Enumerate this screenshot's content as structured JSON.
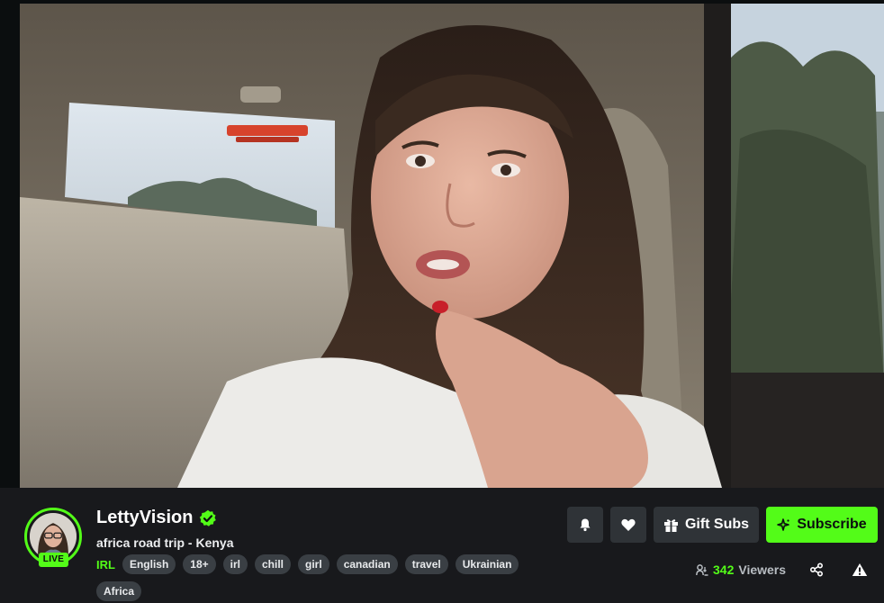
{
  "channel": {
    "name": "LettyVision",
    "verified": true,
    "live_label": "LIVE",
    "stream_title": "africa road trip - Kenya",
    "category": "IRL",
    "tags": [
      "English",
      "18+",
      "irl",
      "chill",
      "girl",
      "canadian",
      "travel",
      "Ukrainian",
      "Africa"
    ]
  },
  "actions": {
    "notify_icon": "bell-icon",
    "follow_icon": "heart-icon",
    "gift_label": "Gift Subs",
    "gift_icon": "gift-icon",
    "subscribe_label": "Subscribe",
    "subscribe_icon": "sparkle-icon"
  },
  "stats": {
    "viewer_count": "342",
    "viewer_label": "Viewers"
  },
  "colors": {
    "accent": "#53fc18",
    "background": "#0b0e0f",
    "panel": "#18191c",
    "button": "#2f3337",
    "tag": "#3a3f44"
  }
}
